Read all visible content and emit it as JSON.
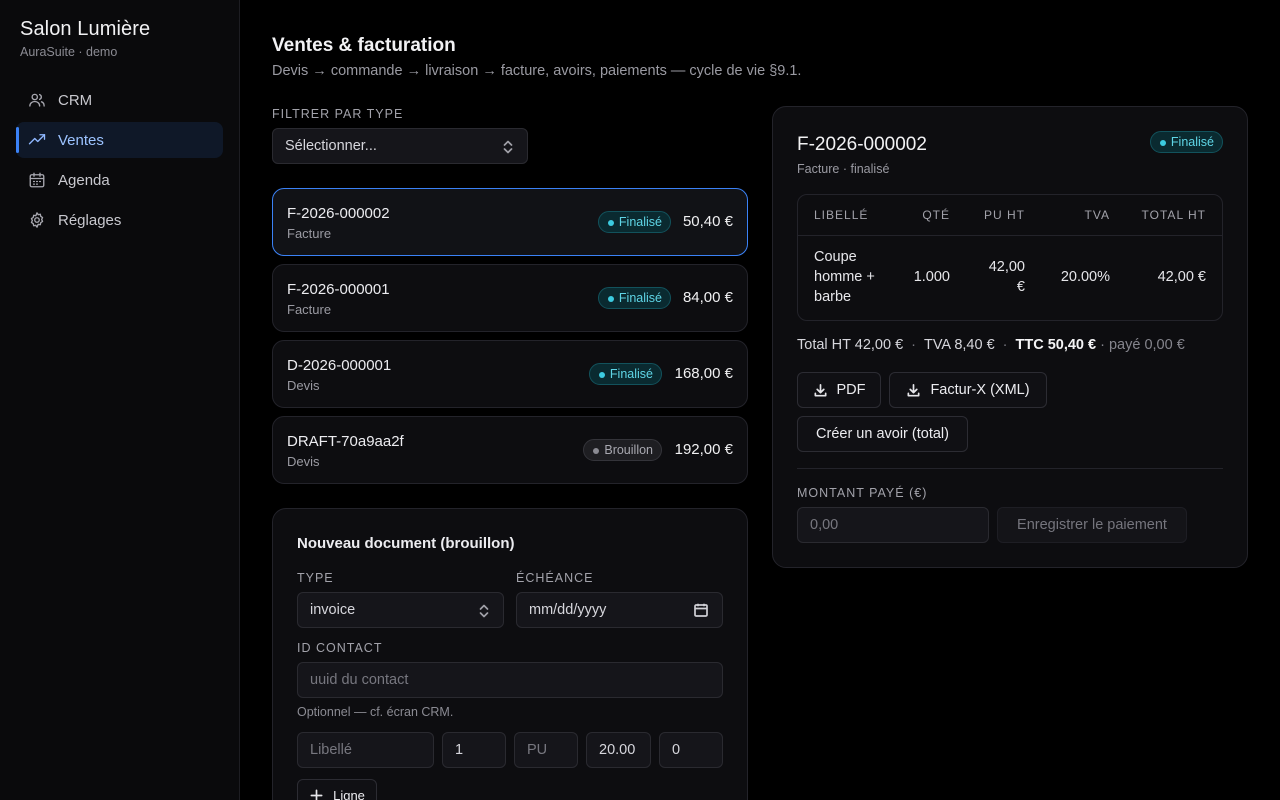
{
  "brand": {
    "title": "Salon Lumière",
    "subtitle": "AuraSuite · demo"
  },
  "nav": [
    {
      "label": "CRM",
      "icon": "users-icon",
      "active": false
    },
    {
      "label": "Ventes",
      "icon": "trending-up-icon",
      "active": true
    },
    {
      "label": "Agenda",
      "icon": "calendar-icon",
      "active": false
    },
    {
      "label": "Réglages",
      "icon": "gear-icon",
      "active": false
    }
  ],
  "header": {
    "title": "Ventes & facturation",
    "subtitle": "Devis → commande → livraison → facture, avoirs, paiements — cycle de vie §9.1."
  },
  "filter": {
    "label": "FILTRER PAR TYPE",
    "placeholder": "Sélectionner..."
  },
  "documents": [
    {
      "number": "F-2026-000002",
      "type": "Facture",
      "status": "Finalisé",
      "amount": "50,40 €",
      "selected": true
    },
    {
      "number": "F-2026-000001",
      "type": "Facture",
      "status": "Finalisé",
      "amount": "84,00 €"
    },
    {
      "number": "D-2026-000001",
      "type": "Devis",
      "status": "Finalisé",
      "amount": "168,00 €"
    },
    {
      "number": "DRAFT-70a9aa2f",
      "type": "Devis",
      "status": "Brouillon",
      "amount": "192,00 €"
    }
  ],
  "new_doc": {
    "title": "Nouveau document (brouillon)",
    "type_label": "TYPE",
    "type_value": "invoice",
    "due_label": "ÉCHÉANCE",
    "due_placeholder": "mm/dd/yyyy",
    "contact_label": "ID CONTACT",
    "contact_placeholder": "uuid du contact",
    "contact_hint": "Optionnel — cf. écran CRM.",
    "line": {
      "label_placeholder": "Libellé",
      "qty": "1",
      "pu_placeholder": "PU",
      "vat": "20.00",
      "discount": "0"
    },
    "add_line": "Ligne"
  },
  "detail": {
    "number": "F-2026-000002",
    "subtitle": "Facture · finalisé",
    "status": "Finalisé",
    "columns": [
      "LIBELLÉ",
      "QTÉ",
      "PU HT",
      "TVA",
      "TOTAL HT"
    ],
    "row": {
      "label_l1": "Coupe",
      "label_l2": "homme +",
      "label_l3": "barbe",
      "qty": "1.000",
      "pu_l1": "42,00",
      "pu_l2": "€",
      "vat": "20.00%",
      "total": "42,00 €"
    },
    "totals": {
      "ht": "Total HT 42,00 €",
      "sep": "·",
      "vat": "TVA 8,40 €",
      "ttc": "TTC 50,40 €",
      "paid": "· payé 0,00 €"
    },
    "pdf_button": "PDF",
    "facturx_button": "Factur-X (XML)",
    "credit_button": "Créer un avoir (total)",
    "paid_label": "MONTANT PAYÉ (€)",
    "paid_placeholder": "0,00",
    "save_payment": "Enregistrer le paiement"
  }
}
